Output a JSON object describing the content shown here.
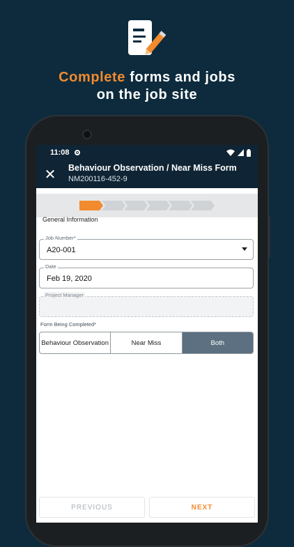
{
  "promo": {
    "headline_accent": "Complete",
    "headline_rest": " forms and jobs",
    "headline_line2": "on the job site",
    "icon": "document-pencil-icon",
    "accent_color": "#f28a2e",
    "background_color": "#0d2b3d"
  },
  "status_bar": {
    "time": "11:08",
    "icons": [
      "settings-gear-icon",
      "wifi-icon",
      "signal-icon",
      "battery-icon"
    ]
  },
  "app_bar": {
    "title": "Behaviour Observation / Near Miss Form",
    "subtitle": "NM200116-452-9",
    "close_icon": "close-icon"
  },
  "stepper": {
    "total_steps": 6,
    "current_step": 1
  },
  "form": {
    "section_title": "General Information",
    "job_number": {
      "label": "Job Number*",
      "value": "A20-001"
    },
    "date": {
      "label": "Date",
      "value": "Feb 19, 2020"
    },
    "project_manager": {
      "label": "Project Manager",
      "value": ""
    },
    "form_being_completed": {
      "label": "Form Being Completed*",
      "options": [
        "Behaviour Observation",
        "Near Miss",
        "Both"
      ],
      "selected": "Both"
    }
  },
  "footer": {
    "previous": "PREVIOUS",
    "next": "NEXT"
  }
}
